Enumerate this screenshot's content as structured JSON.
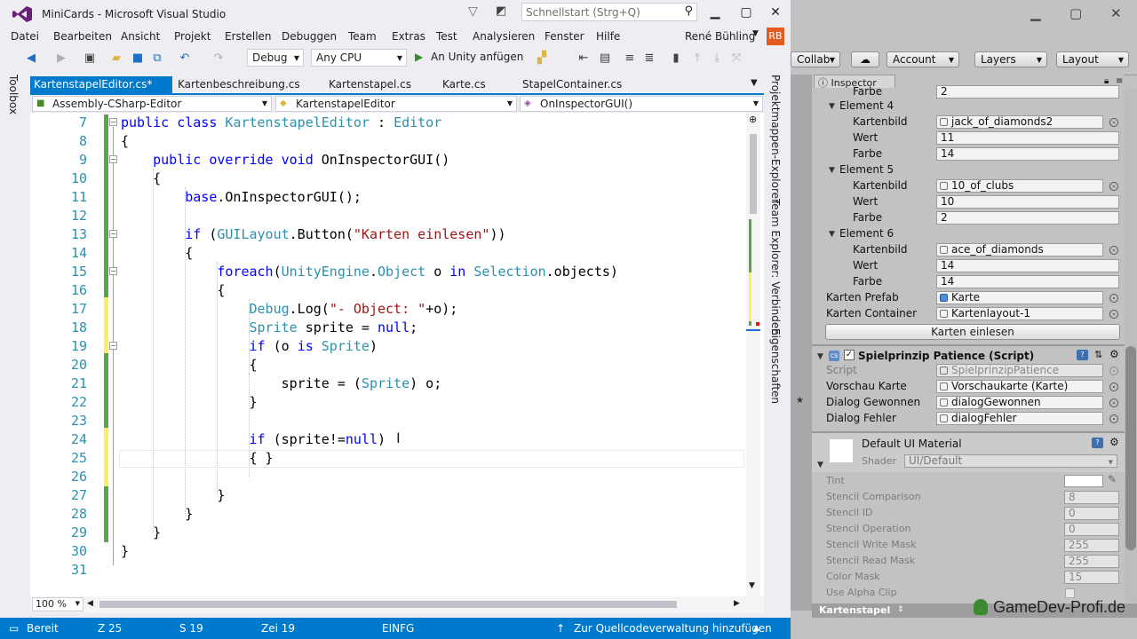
{
  "vs": {
    "title": "MiniCards - Microsoft Visual Studio",
    "quicklaunch_placeholder": "Schnellstart (Strg+Q)",
    "menu": [
      "Datei",
      "Bearbeiten",
      "Ansicht",
      "Projekt",
      "Erstellen",
      "Debuggen",
      "Team",
      "Extras",
      "Test",
      "Analysieren",
      "Fenster",
      "Hilfe"
    ],
    "user": "René Bühling",
    "user_initials": "RB",
    "toolbar": {
      "config": "Debug",
      "platform": "Any CPU",
      "run_label": "An Unity anfügen"
    },
    "toolbox_label": "Toolbox",
    "tabs": [
      {
        "label": "KartenstapelEditor.cs*"
      },
      {
        "label": "Kartenbeschreibung.cs"
      },
      {
        "label": "Kartenstapel.cs"
      },
      {
        "label": "Karte.cs"
      },
      {
        "label": "StapelContainer.cs"
      }
    ],
    "nav": {
      "project": "Assembly-CSharp-Editor",
      "class": "KartenstapelEditor",
      "member": "OnInspectorGUI()"
    },
    "line_numbers": [
      "7",
      "8",
      "9",
      "10",
      "11",
      "12",
      "13",
      "14",
      "15",
      "16",
      "17",
      "18",
      "19",
      "20",
      "21",
      "22",
      "23",
      "24",
      "25",
      "26",
      "27",
      "28",
      "29",
      "30",
      "31"
    ],
    "right_tabs": [
      "Projektmappen-Explorer",
      "Team Explorer: Verbinden",
      "Eigenschaften"
    ],
    "zoom": "100 %",
    "status": {
      "ready": "Bereit",
      "line": "Z 25",
      "col": "S 19",
      "char": "Zei 19",
      "mode": "EINFG",
      "source_control": "Zur Quellcodeverwaltung hinzufügen"
    },
    "colors": {
      "accent": "#007acc",
      "keyword": "#0000ff",
      "type": "#2b91af",
      "string": "#a31515"
    }
  },
  "unity": {
    "toolbar": {
      "collab": "Collab",
      "account": "Account",
      "layers": "Layers",
      "layout": "Layout"
    },
    "inspector_tab": "Inspector",
    "rows": {
      "farbe_top": {
        "label": "Farbe",
        "value": "2"
      },
      "element4": "Element 4",
      "e4_bild": {
        "label": "Kartenbild",
        "value": "jack_of_diamonds2"
      },
      "e4_wert": {
        "label": "Wert",
        "value": "11"
      },
      "e4_farbe": {
        "label": "Farbe",
        "value": "14"
      },
      "element5": "Element 5",
      "e5_bild": {
        "label": "Kartenbild",
        "value": "10_of_clubs"
      },
      "e5_wert": {
        "label": "Wert",
        "value": "10"
      },
      "e5_farbe": {
        "label": "Farbe",
        "value": "2"
      },
      "element6": "Element 6",
      "e6_bild": {
        "label": "Kartenbild",
        "value": "ace_of_diamonds"
      },
      "e6_wert": {
        "label": "Wert",
        "value": "14"
      },
      "e6_farbe": {
        "label": "Farbe",
        "value": "14"
      },
      "prefab": {
        "label": "Karten Prefab",
        "value": "Karte"
      },
      "container": {
        "label": "Karten Container",
        "value": "Kartenlayout-1"
      },
      "button": "Karten einlesen"
    },
    "script_component": {
      "title": "Spielprinzip Patience (Script)",
      "script": {
        "label": "Script",
        "value": "SpielprinzipPatience"
      },
      "vorschau": {
        "label": "Vorschau Karte",
        "value": "Vorschaukarte (Karte)"
      },
      "gewonnen": {
        "label": "Dialog Gewonnen",
        "value": "dialogGewonnen"
      },
      "fehler": {
        "label": "Dialog Fehler",
        "value": "dialogFehler"
      }
    },
    "material": {
      "title": "Default UI Material",
      "shader_label": "Shader",
      "shader_value": "UI/Default",
      "props": [
        {
          "label": "Tint",
          "value": ""
        },
        {
          "label": "Stencil Comparison",
          "value": "8"
        },
        {
          "label": "Stencil ID",
          "value": "0"
        },
        {
          "label": "Stencil Operation",
          "value": "0"
        },
        {
          "label": "Stencil Write Mask",
          "value": "255"
        },
        {
          "label": "Stencil Read Mask",
          "value": "255"
        },
        {
          "label": "Color Mask",
          "value": "15"
        },
        {
          "label": "Use Alpha Clip",
          "value": ""
        }
      ]
    },
    "bottom_object": "Kartenstapel",
    "watermark": "GameDev-Profi.de"
  }
}
